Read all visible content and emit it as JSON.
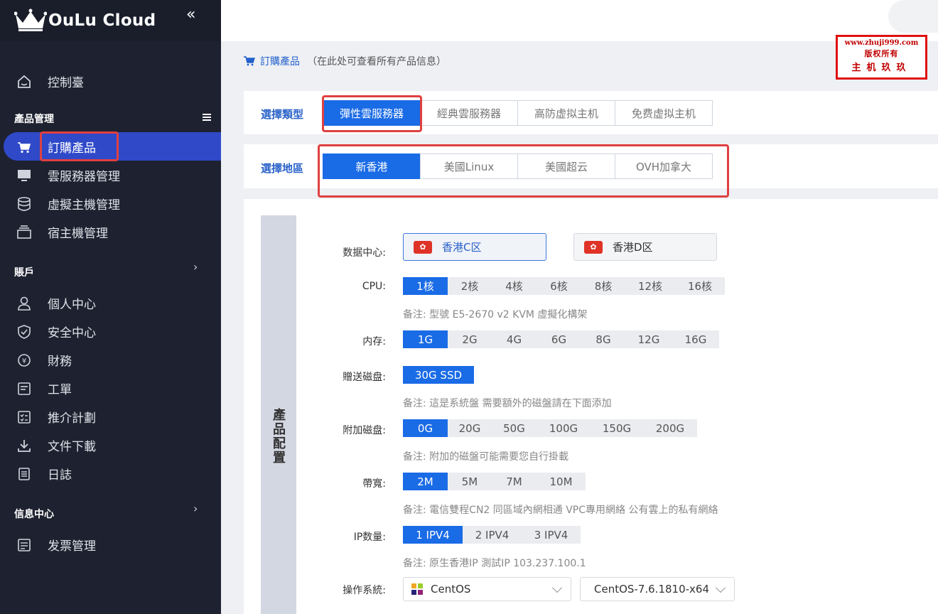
{
  "app": {
    "logo_text": "OuLu Cloud"
  },
  "sidebar": {
    "items_top": [
      {
        "label": "控制臺",
        "icon": "home-icon"
      }
    ],
    "section_products": "產品管理",
    "items_products": [
      {
        "label": "訂購產品",
        "icon": "cart-icon",
        "active": true
      },
      {
        "label": "雲服務器管理",
        "icon": "monitor-icon"
      },
      {
        "label": "虛擬主機管理",
        "icon": "database-icon"
      },
      {
        "label": "宿主機管理",
        "icon": "server-icon"
      }
    ],
    "section_account": "賬戶",
    "items_account": [
      {
        "label": "個人中心",
        "icon": "user-icon"
      },
      {
        "label": "安全中心",
        "icon": "shield-icon"
      },
      {
        "label": "財務",
        "icon": "money-icon"
      },
      {
        "label": "工單",
        "icon": "ticket-icon"
      },
      {
        "label": "推介計劃",
        "icon": "checklist-icon"
      },
      {
        "label": "文件下載",
        "icon": "download-icon"
      },
      {
        "label": "日誌",
        "icon": "log-icon"
      }
    ],
    "section_info": "信息中心",
    "items_info": [
      {
        "label": "发票管理",
        "icon": "invoice-icon"
      }
    ]
  },
  "breadcrumb": {
    "title": "訂購產品",
    "note": "（在此处可查看所有产品信息）"
  },
  "watermark": {
    "line1": "www.zhuji999.com",
    "line2": "版权所有",
    "line3": "主机玖玖"
  },
  "type_select": {
    "label": "選擇類型",
    "options": [
      "彈性雲服務器",
      "經典雲服務器",
      "高防虚拟主机",
      "免费虚拟主机"
    ],
    "selected": 0
  },
  "region_select": {
    "label": "選擇地區",
    "options": [
      "新香港",
      "美國Linux",
      "美國超云",
      "OVH加拿大"
    ],
    "selected": 0
  },
  "config": {
    "side_title": "產品配置",
    "datacenter": {
      "label": "数据中心:",
      "options": [
        "香港C区",
        "香港D区"
      ],
      "selected": 0
    },
    "cpu": {
      "label": "CPU:",
      "options": [
        "1核",
        "2核",
        "4核",
        "6核",
        "8核",
        "12核",
        "16核"
      ],
      "selected": 0,
      "note": "备注: 型號 E5-2670 v2 KVM 虛擬化構架"
    },
    "memory": {
      "label": "内存:",
      "options": [
        "1G",
        "2G",
        "4G",
        "6G",
        "8G",
        "12G",
        "16G"
      ],
      "selected": 0
    },
    "free_disk": {
      "label": "贈送磁盘:",
      "options": [
        "30G SSD"
      ],
      "selected": 0,
      "note": "备注: 這是系統盤 需要額外的磁盤請在下面添加"
    },
    "extra_disk": {
      "label": "附加磁盘:",
      "options": [
        "0G",
        "20G",
        "50G",
        "100G",
        "150G",
        "200G"
      ],
      "selected": 0,
      "note": "备注: 附加的磁盤可能需要您自行掛載"
    },
    "bandwidth": {
      "label": "帶寬:",
      "options": [
        "2M",
        "5M",
        "7M",
        "10M"
      ],
      "selected": 0,
      "note": "备注: 電信雙程CN2 同區域內網相通 VPC專用網絡 公有雲上的私有網絡"
    },
    "ip": {
      "label": "IP数量:",
      "options": [
        "1 IPV4",
        "2 IPV4",
        "3 IPV4"
      ],
      "selected": 0,
      "note": "备注: 原生香港IP 測試IP 103.237.100.1"
    },
    "os": {
      "label": "操作系統:",
      "family": "CentOS",
      "version": "CentOS-7.6.1810-x64"
    }
  },
  "colors": {
    "accent": "#1a6be6",
    "sidebar_bg": "#1e2230",
    "active_nav": "#2f49c9",
    "highlight_red": "#e04040"
  }
}
